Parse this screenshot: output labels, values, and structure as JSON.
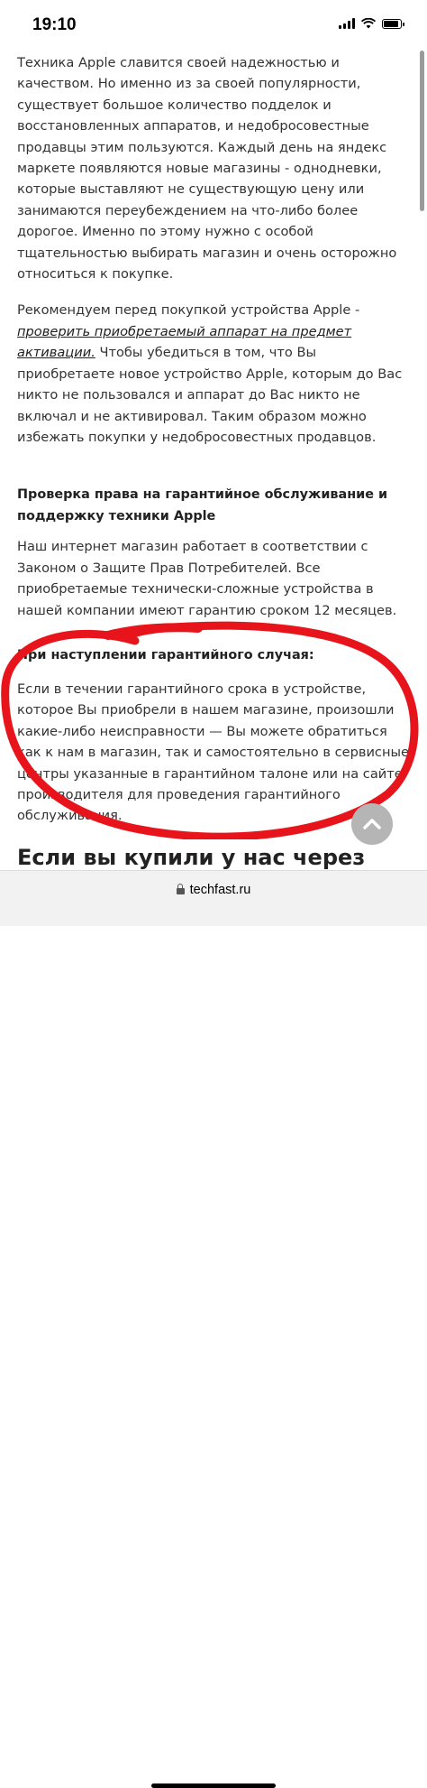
{
  "status_bar": {
    "time": "19:10",
    "icons": [
      "signal-icon",
      "wifi-icon",
      "battery-icon"
    ]
  },
  "article": {
    "paragraph1": "Техника Apple славится своей надежностью и качеством. Но именно из за своей популярности, существует большое количество подделок и восстановленных аппаратов, и недобросовестные продавцы этим пользуются. Каждый день на яндекс маркете появляются новые магазины - однодневки, которые выставляют не существующую цену или занимаются переубеждением на что-либо более дорогое. Именно по этому нужно с особой тщательностью выбирать магазин и очень осторожно относиться к покупке.",
    "paragraph2_before": "Рекомендуем перед покупкой устройства Apple - ",
    "paragraph2_link": "проверить приобретаемый аппарат на предмет активации.",
    "paragraph2_after": " Чтобы убедиться в том, что Вы приобретаете новое устройство Apple, которым до Вас никто не пользовался и аппарат до Вас никто не включал и не активировал. Таким образом можно избежать покупки у недобросовестных продавцов.",
    "section_heading": "Проверка права на гарантийное обслуживание и поддержку техники Apple",
    "paragraph3": "Наш интернет магазин работает в соответствии с Законом о Защите Прав Потребителей. Все приобретаемые технически-сложные устройства в нашей компании имеют гарантию сроком 12 месяцев.",
    "warranty_heading": "При наступлении гарантийного случая:",
    "paragraph4": "Если в течении гарантийного срока в устройстве, которое Вы приобрели в нашем магазине, произошли какие-либо неисправности — Вы можете обратиться как к нам в магазин, так и самостоятельно в сервисные центры указанные в гарантийном талоне или на сайте производителя для проведения гарантийного обслуживания.",
    "next_heading": "Если вы купили у нас через"
  },
  "scroll_top_button": {
    "icon": "chevron-up-icon"
  },
  "url_bar": {
    "domain": "techfast.ru",
    "icon": "lock-icon"
  },
  "colors": {
    "annotation": "#e8141b",
    "text": "#333333"
  }
}
